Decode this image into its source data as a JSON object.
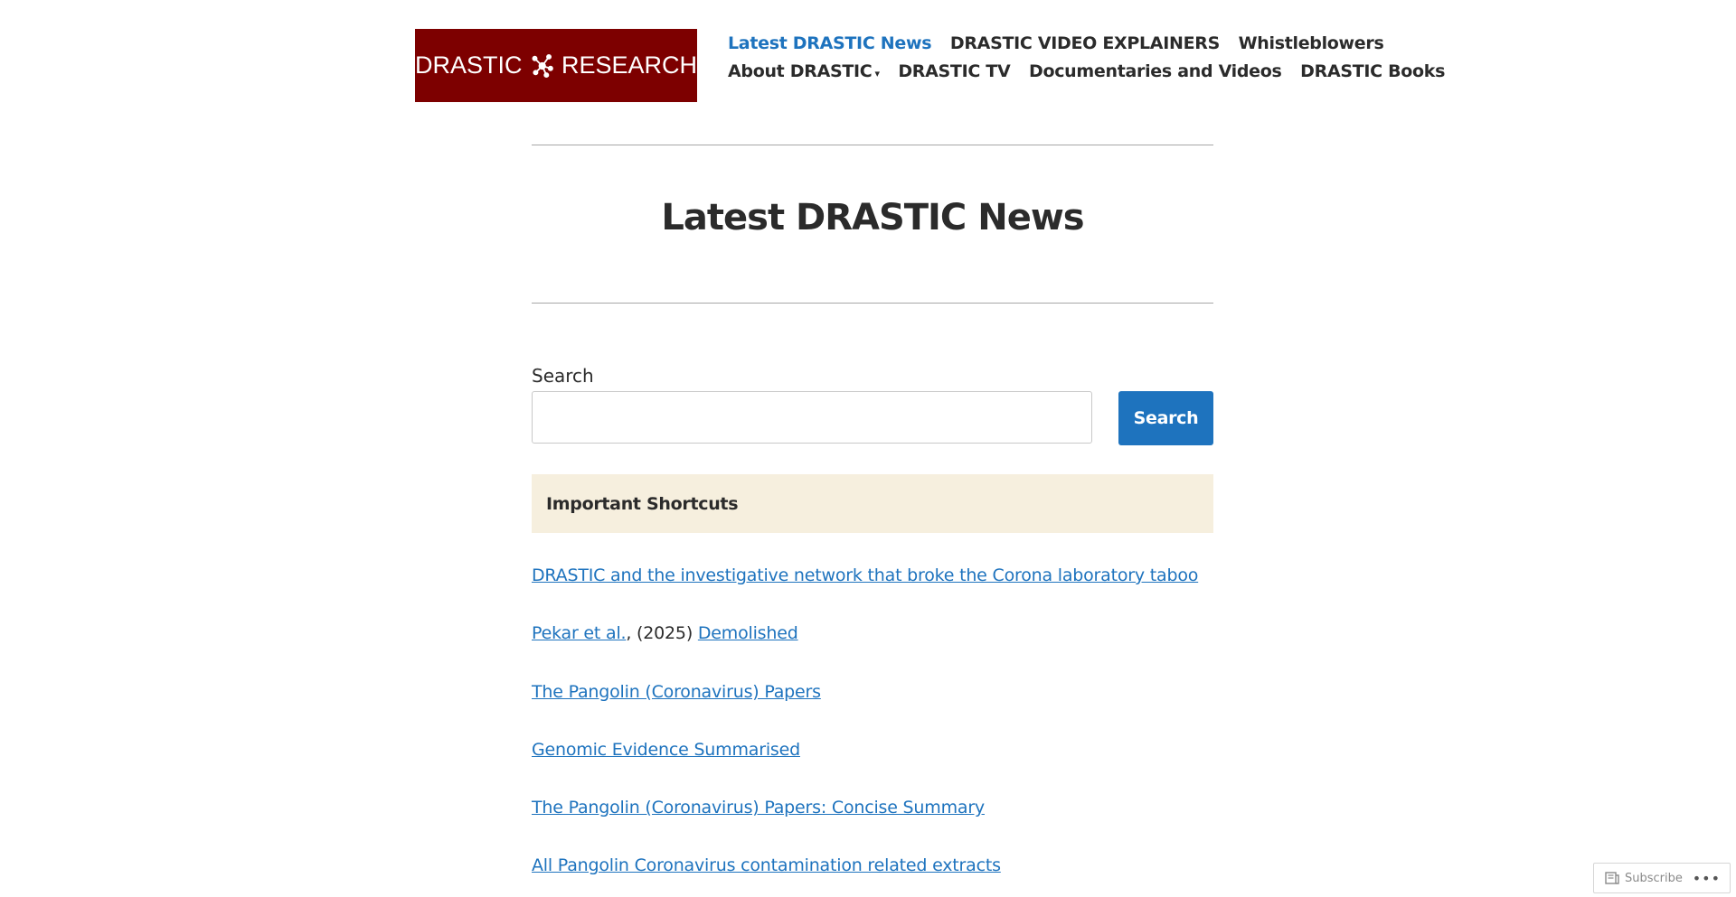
{
  "header": {
    "logo": {
      "left_word": "DRASTIC",
      "right_word": "RESEARCH",
      "background": "#7d0000"
    },
    "nav_row1": [
      {
        "label": "Latest DRASTIC News",
        "active": true
      },
      {
        "label": "DRASTIC VIDEO EXPLAINERS",
        "active": false
      },
      {
        "label": "Whistleblowers",
        "active": false
      }
    ],
    "nav_row2": [
      {
        "label": "About DRASTIC",
        "has_dropdown": true,
        "caret": "▾"
      },
      {
        "label": "DRASTIC TV"
      },
      {
        "label": "Documentaries and Videos"
      },
      {
        "label": "DRASTIC Books"
      }
    ]
  },
  "main": {
    "page_title": "Latest DRASTIC News",
    "search": {
      "label": "Search",
      "value": "",
      "placeholder": "",
      "button_label": "Search"
    },
    "shortcuts": {
      "heading": "Important Shortcuts",
      "items": [
        {
          "link": "DRASTIC and the investigative network that broke the Corona laboratory taboo"
        },
        {
          "link_a": "Pekar et al.",
          "text": ", (2025) ",
          "link_b": "Demolished"
        },
        {
          "link": "The Pangolin (Coronavirus) Papers"
        },
        {
          "link": "Genomic Evidence Summarised"
        },
        {
          "link": "The Pangolin (Coronavirus) Papers: Concise Summary"
        },
        {
          "link": "All Pangolin Coronavirus contamination related extracts"
        }
      ]
    }
  },
  "subscribe_bar": {
    "label": "Subscribe",
    "more": "•••"
  },
  "colors": {
    "accent": "#1e73be",
    "text": "#2b2b2b",
    "shortcuts_bg": "#f6efde",
    "logo_bg": "#7d0000"
  }
}
